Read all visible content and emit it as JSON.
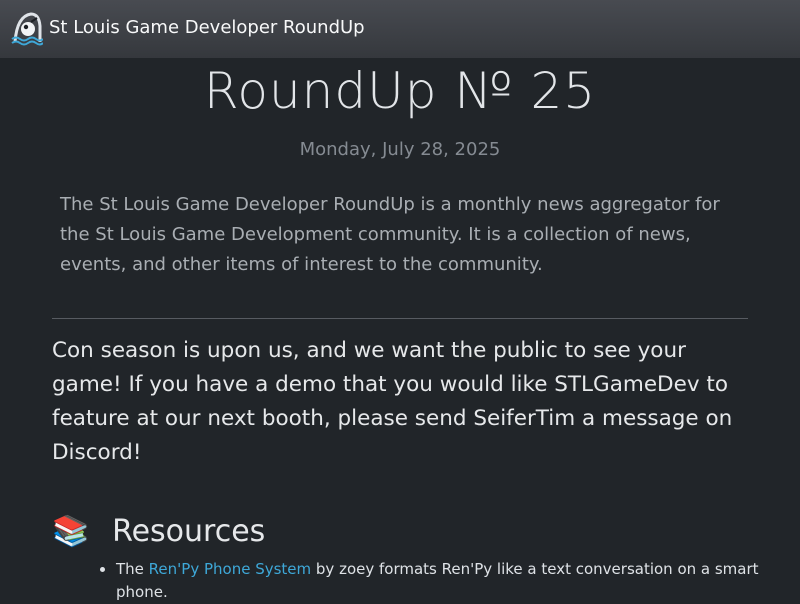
{
  "header": {
    "brand": "St Louis Game Developer RoundUp",
    "logo_icon": "stl-arch-mascot-icon"
  },
  "article": {
    "title": "RoundUp № 25",
    "date": "Monday, July 28, 2025",
    "intro": "The St Louis Game Developer RoundUp is a monthly news aggregator for the St Louis Game Development community. It is a collection of news, events, and other items of interest to the community.",
    "announcement": "Con season is upon us, and we want the public to see your game! If you have a demo that you would like STLGameDev to feature at our next booth, please send SeiferTim a message on Discord!"
  },
  "sections": [
    {
      "emoji": "📚",
      "emoji_icon": "books-icon",
      "title": "Resources",
      "items": [
        {
          "prefix": "The ",
          "link_text": "Ren'Py Phone System",
          "suffix": " by zoey formats Ren'Py like a text conversation on a smart phone."
        }
      ]
    }
  ],
  "colors": {
    "background": "#212529",
    "navbar": "#3e4147",
    "link": "#3ea8d8",
    "muted_text": "#858b92"
  }
}
